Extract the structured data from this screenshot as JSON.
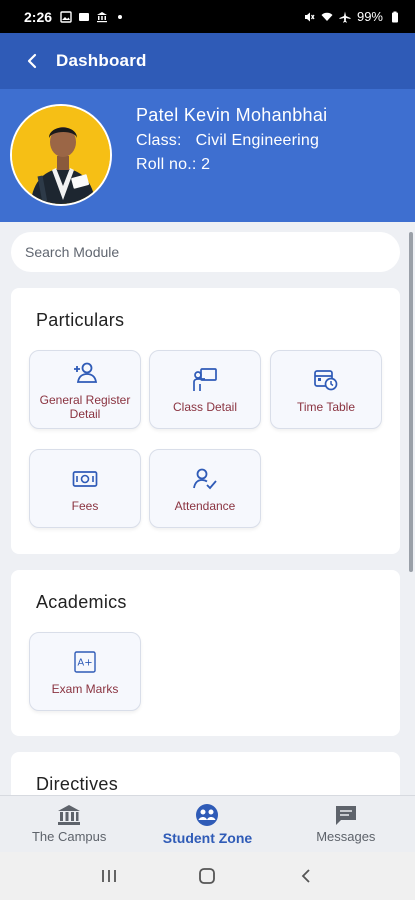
{
  "status_bar": {
    "time": "2:26",
    "battery": "99%"
  },
  "app_bar": {
    "title": "Dashboard"
  },
  "profile": {
    "name": "Patel Kevin Mohanbhai",
    "class_label": "Class:",
    "class_value": "Civil Engineering",
    "roll": "Roll no.: 2"
  },
  "search": {
    "placeholder": "Search Module"
  },
  "sections": {
    "particulars": {
      "title": "Particulars",
      "tiles": [
        {
          "label": "General Register Detail",
          "icon": "add-user-icon"
        },
        {
          "label": "Class Detail",
          "icon": "class-presenter-icon"
        },
        {
          "label": "Time Table",
          "icon": "calendar-clock-icon"
        },
        {
          "label": "Fees",
          "icon": "money-icon"
        },
        {
          "label": "Attendance",
          "icon": "user-check-icon"
        }
      ]
    },
    "academics": {
      "title": "Academics",
      "tiles": [
        {
          "label": "Exam Marks",
          "icon": "grade-icon"
        }
      ]
    },
    "directives": {
      "title": "Directives"
    }
  },
  "bottom_nav": [
    {
      "label": "The Campus",
      "icon": "campus-icon",
      "active": false
    },
    {
      "label": "Student Zone",
      "icon": "student-zone-icon",
      "active": true
    },
    {
      "label": "Messages",
      "icon": "messages-icon",
      "active": false
    }
  ],
  "colors": {
    "primary": "#2f5bb7",
    "header": "#3e6fd0",
    "tile_label": "#8a3340",
    "avatar_bg": "#f6bf15"
  }
}
